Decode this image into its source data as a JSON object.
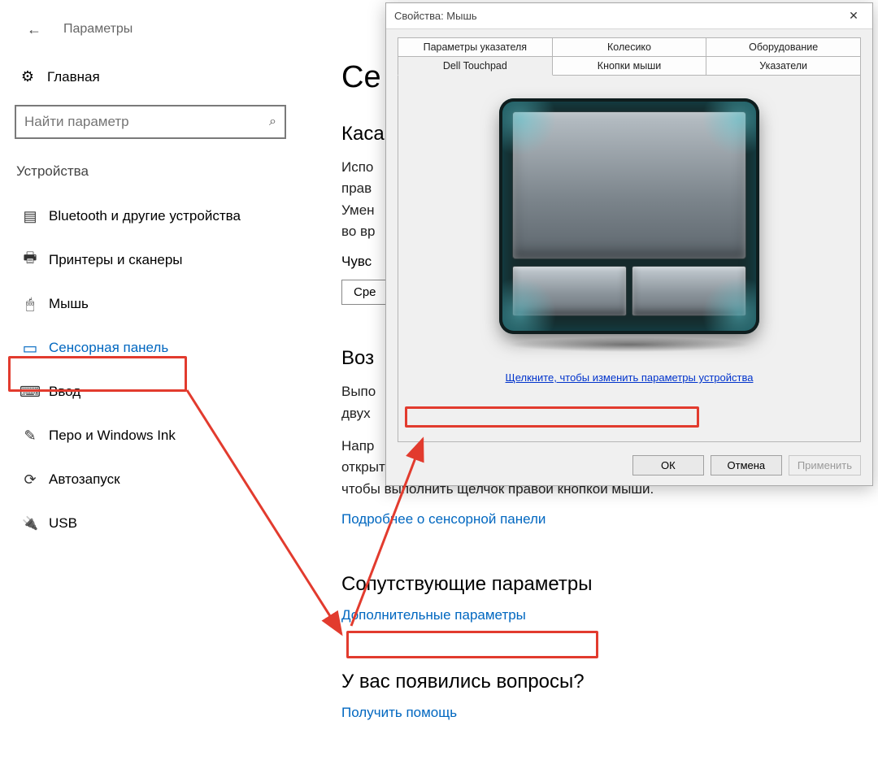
{
  "header": {
    "title": "Параметры"
  },
  "sidebar": {
    "home_label": "Главная",
    "search_placeholder": "Найти параметр",
    "category_label": "Устройства",
    "items": [
      {
        "id": "bluetooth",
        "icon": "bt",
        "label": "Bluetooth и другие устройства",
        "active": false
      },
      {
        "id": "printers",
        "icon": "print",
        "label": "Принтеры и сканеры",
        "active": false
      },
      {
        "id": "mouse",
        "icon": "mouse",
        "label": "Мышь",
        "active": false
      },
      {
        "id": "touchpad",
        "icon": "touchpad",
        "label": "Сенсорная панель",
        "active": true
      },
      {
        "id": "typing",
        "icon": "keyboard",
        "label": "Ввод",
        "active": false
      },
      {
        "id": "pen",
        "icon": "pen",
        "label": "Перо и Windows Ink",
        "active": false
      },
      {
        "id": "autoplay",
        "icon": "autoplay",
        "label": "Автозапуск",
        "active": false
      },
      {
        "id": "usb",
        "icon": "usb",
        "label": "USB",
        "active": false
      }
    ]
  },
  "content": {
    "page_title_prefix": "Се",
    "touches_heading_prefix": "Каса",
    "touches_body_prefix_lines": [
      "Испо",
      "прав",
      "Умен",
      "во вр"
    ],
    "sensitivity_label_prefix": "Чувс",
    "sensitivity_value_prefix": "Сре",
    "scrolling_heading_prefix": "Воз",
    "scrolling_body_prefix_lines": [
      "Выпо",
      "двух"
    ],
    "scrolling_body2_prefix": "Напр",
    "scrolling_body2_rest": "открытые приложения, или один раз коснитесь приложения двумя пальцами, чтобы выполнить щелчок правой кнопкой мыши.",
    "learn_more_link": "Подробнее о сенсорной панели",
    "related_heading": "Сопутствующие параметры",
    "related_link": "Дополнительные параметры",
    "questions_heading": "У вас появились вопросы?",
    "help_link": "Получить помощь"
  },
  "dialog": {
    "title": "Свойства: Мышь",
    "tabs_row1": [
      "Параметры указателя",
      "Колесико",
      "Оборудование"
    ],
    "tabs_row2": [
      "Dell Touchpad",
      "Кнопки мыши",
      "Указатели"
    ],
    "active_tab": "Dell Touchpad",
    "change_link": "Щелкните, чтобы изменить параметры устройства ",
    "buttons": {
      "ok": "ОК",
      "cancel": "Отмена",
      "apply": "Применить"
    }
  }
}
